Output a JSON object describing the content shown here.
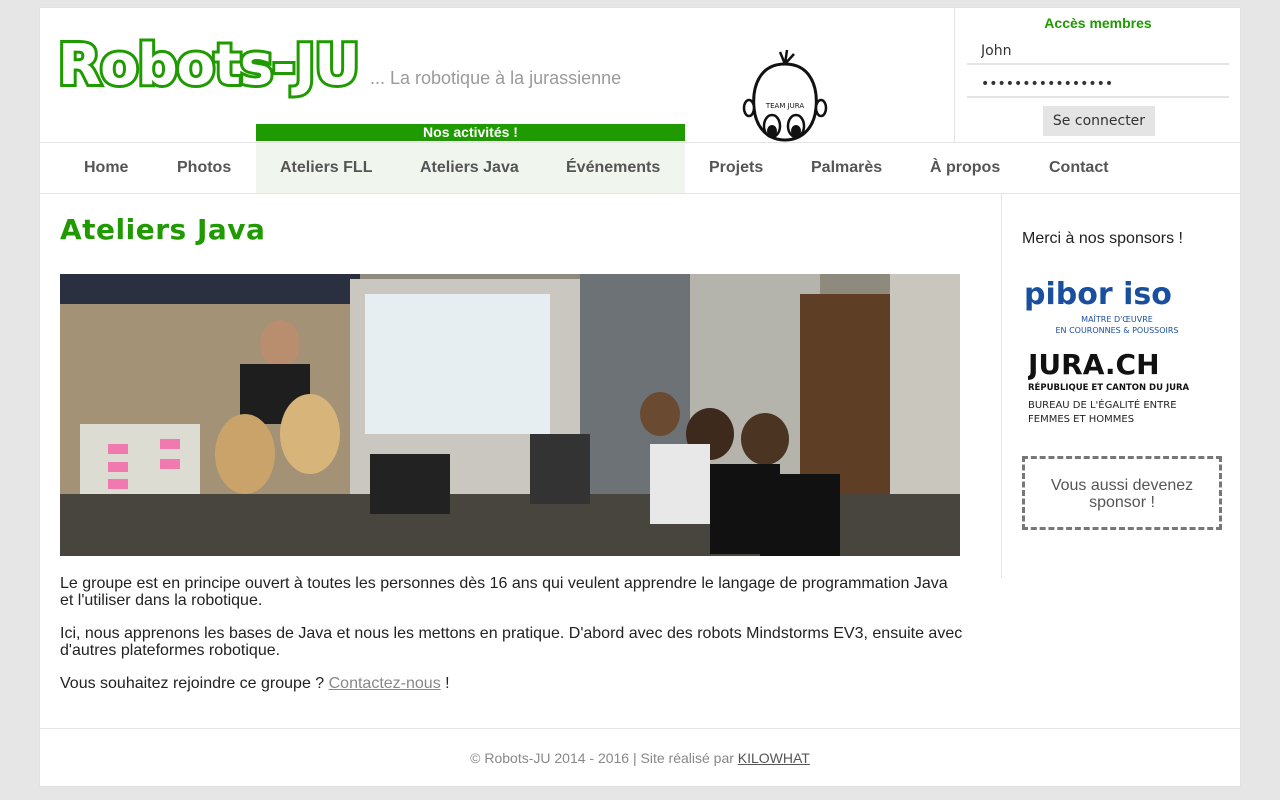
{
  "header": {
    "logo": "Robots-JU",
    "tagline": "... La robotique à la jurassienne",
    "activities_banner": "Nos activités !",
    "mascot_text": "TEAM JURA"
  },
  "member": {
    "title": "Accès membres",
    "username": "John",
    "password": "••••••••••••••••",
    "login_label": "Se connecter"
  },
  "nav": {
    "items": [
      {
        "label": "Home"
      },
      {
        "label": "Photos"
      },
      {
        "label": "Ateliers FLL"
      },
      {
        "label": "Ateliers Java"
      },
      {
        "label": "Événements"
      },
      {
        "label": "Projets"
      },
      {
        "label": "Palmarès"
      },
      {
        "label": "À propos"
      },
      {
        "label": "Contact"
      }
    ]
  },
  "main": {
    "title": "Ateliers Java",
    "p1": "Le groupe est en principe ouvert à toutes les personnes dès 16 ans qui veulent apprendre le langage de programmation Java et l'utiliser dans la robotique.",
    "p2": "Ici, nous apprenons les bases de Java et nous les mettons en pratique. D'abord avec des robots Mindstorms EV3, ensuite avec d'autres plateformes robotique.",
    "p3_before": "Vous souhaitez rejoindre ce groupe ? ",
    "p3_link": "Contactez-nous",
    "p3_after": " !"
  },
  "sidebar": {
    "title": "Merci à nos sponsors !",
    "sponsor1_name": "pibor iso",
    "sponsor1_sub1": "MAÎTRE D'ŒUVRE",
    "sponsor1_sub2": "EN COURONNES & POUSSOIRS",
    "sponsor2_name": "JURA.CH",
    "sponsor2_sub1": "RÉPUBLIQUE ET CANTON DU JURA",
    "sponsor2_sub2": "BUREAU DE L'ÉGALITÉ ENTRE",
    "sponsor2_sub3": "FEMMES ET HOMMES",
    "become": "Vous aussi devenez sponsor !"
  },
  "footer": {
    "text": "© Robots-JU 2014 - 2016 | Site réalisé par ",
    "link": "KILOWHAT"
  },
  "colors": {
    "brand_green": "#1f9a00",
    "nav_active_bg": "#f0f6ee",
    "page_bg": "#e6e6e6"
  }
}
